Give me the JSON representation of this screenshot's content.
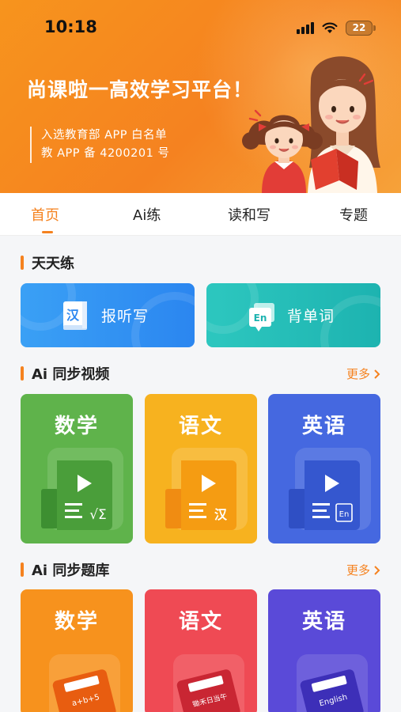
{
  "status_bar": {
    "time": "10:18",
    "battery": "22"
  },
  "banner": {
    "title": "尚课啦一高效学习平台！",
    "sub_lines": [
      "入选教育部 APP 白名单",
      "教 APP 备 4200201 号"
    ]
  },
  "tabs": [
    {
      "label": "首页",
      "active": true
    },
    {
      "label": "Ai练",
      "active": false
    },
    {
      "label": "读和写",
      "active": false
    },
    {
      "label": "专题",
      "active": false
    }
  ],
  "daily_practice": {
    "title": "天天练",
    "cards": [
      {
        "label": "报听写",
        "icon": "dictation-book-icon",
        "icon_glyph": "汉"
      },
      {
        "label": "背单词",
        "icon": "english-word-icon",
        "icon_glyph": "En"
      }
    ]
  },
  "sync_video": {
    "title": "Ai 同步视频",
    "more": "更多",
    "cards": [
      {
        "subject": "数学",
        "color": "#5fb34b",
        "badge": "√Σ"
      },
      {
        "subject": "语文",
        "color": "#f7b21f",
        "badge": "汉"
      },
      {
        "subject": "英语",
        "color": "#4568e0",
        "badge": "En"
      }
    ]
  },
  "sync_questions": {
    "title": "Ai 同步题库",
    "more": "更多",
    "cards": [
      {
        "subject": "数学",
        "color": "#f7921d",
        "paper_text": "a+b+5"
      },
      {
        "subject": "语文",
        "color": "#ef4a54",
        "paper_text": "锄禾日当午"
      },
      {
        "subject": "英语",
        "color": "#5a4ad8",
        "paper_text": "English"
      }
    ]
  }
}
